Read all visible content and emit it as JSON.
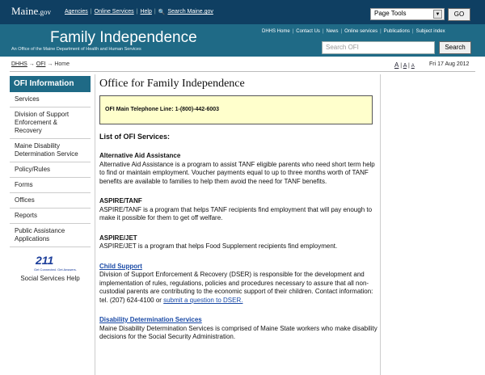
{
  "header": {
    "brand": "Maine",
    "brand_suffix": ".gov",
    "links": [
      "Agencies",
      "Online Services",
      "Help",
      "Search Maine.gov"
    ],
    "page_tools": "Page Tools",
    "go_label": "GO"
  },
  "banner": {
    "title": "Family Independence",
    "subtitle": "An Office of the Maine Department of Health and Human Services",
    "nav": [
      "DHHS Home",
      "Contact Us",
      "News",
      "Online services",
      "Publications",
      "Subject index"
    ],
    "search_placeholder": "Search OFI",
    "search_label": "Search"
  },
  "breadcrumb": {
    "items": [
      "DHHS",
      "OFI",
      "Home"
    ],
    "sep": "→"
  },
  "text_size": {
    "large": "A",
    "medium": "A",
    "small": "A"
  },
  "date": "Fri 17 Aug 2012",
  "sidebar": {
    "heading": "OFI Information",
    "items": [
      "Services",
      "Division of Support Enforcement & Recovery",
      "Maine Disability Determination Service",
      "Policy/Rules",
      "Forms",
      "Offices",
      "Reports",
      "Public Assistance Applications"
    ],
    "logo_number": "211",
    "logo_text": "Get Connected. Get Answers.",
    "caption": "Social Services Help"
  },
  "main": {
    "title": "Office for Family Independence",
    "phone": "OFI Main Telephone Line: 1-(800)-442-6003",
    "list_title": "List of OFI Services:",
    "services": [
      {
        "name": "Alternative Aid Assistance",
        "desc": "Alternative Aid Assistance is a program to assist TANF eligible parents who need short term help to find or maintain employment. Voucher payments equal to up to three months worth of TANF benefits are available to families to help them avoid the need for TANF benefits."
      },
      {
        "name": "ASPIRE/TANF",
        "desc": "ASPIRE/TANF is a program that helps TANF recipients find employment that will pay enough to make it possible for them to get off welfare."
      },
      {
        "name": "ASPIRE/JET",
        "desc": "ASPIRE/JET is a program that helps Food Supplement recipients find employment."
      },
      {
        "name": "Child Support",
        "desc": "Division of Support Enforcement & Recovery (DSER) is responsible for the development and implementation of rules, regulations, policies and procedures necessary to assure that all non-custodial parents are contributing to the economic support of their children. Contact information: tel. (207) 624-4100 or",
        "link": "submit a question to DSER."
      },
      {
        "name": "Disability Determination Services",
        "desc": "Maine Disability Determination Services is comprised of Maine State workers who make disability decisions for the Social Security Administration."
      }
    ]
  }
}
